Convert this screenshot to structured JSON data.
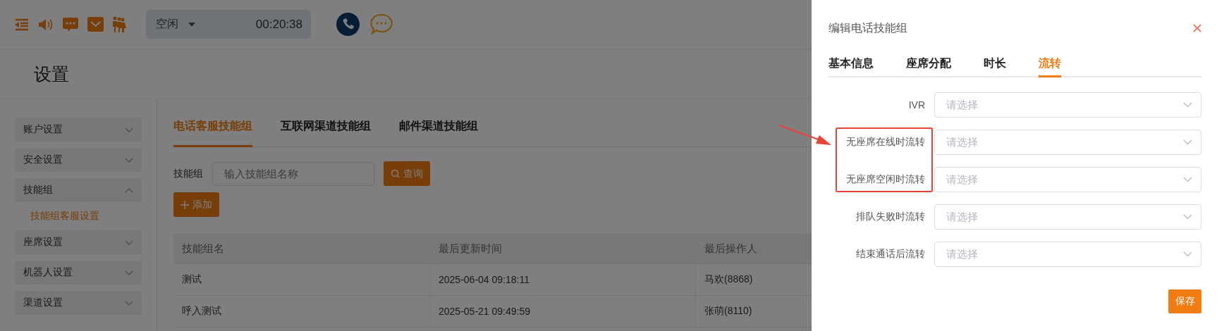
{
  "topbar": {
    "status": {
      "label": "空闲",
      "timer": "00:20:38"
    }
  },
  "page": {
    "title": "设置"
  },
  "sidebar": {
    "items": [
      {
        "label": "账户设置",
        "expanded": false
      },
      {
        "label": "安全设置",
        "expanded": false
      },
      {
        "label": "技能组",
        "expanded": true,
        "children": [
          {
            "label": "技能组客服设置",
            "selected": true
          }
        ]
      },
      {
        "label": "座席设置",
        "expanded": false
      },
      {
        "label": "机器人设置",
        "expanded": false
      },
      {
        "label": "渠道设置",
        "expanded": false
      }
    ]
  },
  "tabs": [
    {
      "label": "电话客服技能组",
      "selected": true
    },
    {
      "label": "互联网渠道技能组",
      "selected": false
    },
    {
      "label": "邮件渠道技能组",
      "selected": false
    }
  ],
  "search": {
    "label": "技能组",
    "placeholder": "输入技能组名称",
    "button": "查询"
  },
  "add_button": "添加",
  "table": {
    "columns": [
      "技能组名",
      "最后更新时间",
      "最后操作人"
    ],
    "rows": [
      [
        "测试",
        "2025-06-04 09:18:11",
        "马欢(8868)"
      ],
      [
        "呼入测试",
        "2025-05-21 09:49:59",
        "张萌(8110)"
      ]
    ]
  },
  "drawer": {
    "title": "编辑电话技能组",
    "tabs": [
      {
        "label": "基本信息",
        "selected": false
      },
      {
        "label": "座席分配",
        "selected": false
      },
      {
        "label": "时长",
        "selected": false
      },
      {
        "label": "流转",
        "selected": true
      }
    ],
    "fields": [
      {
        "label": "IVR",
        "placeholder": "请选择"
      },
      {
        "label": "无座席在线时流转",
        "placeholder": "请选择"
      },
      {
        "label": "无座席空闲时流转",
        "placeholder": "请选择"
      },
      {
        "label": "排队失败时流转",
        "placeholder": "请选择"
      },
      {
        "label": "结束通话后流转",
        "placeholder": "请选择"
      }
    ],
    "save_button": "保存"
  }
}
